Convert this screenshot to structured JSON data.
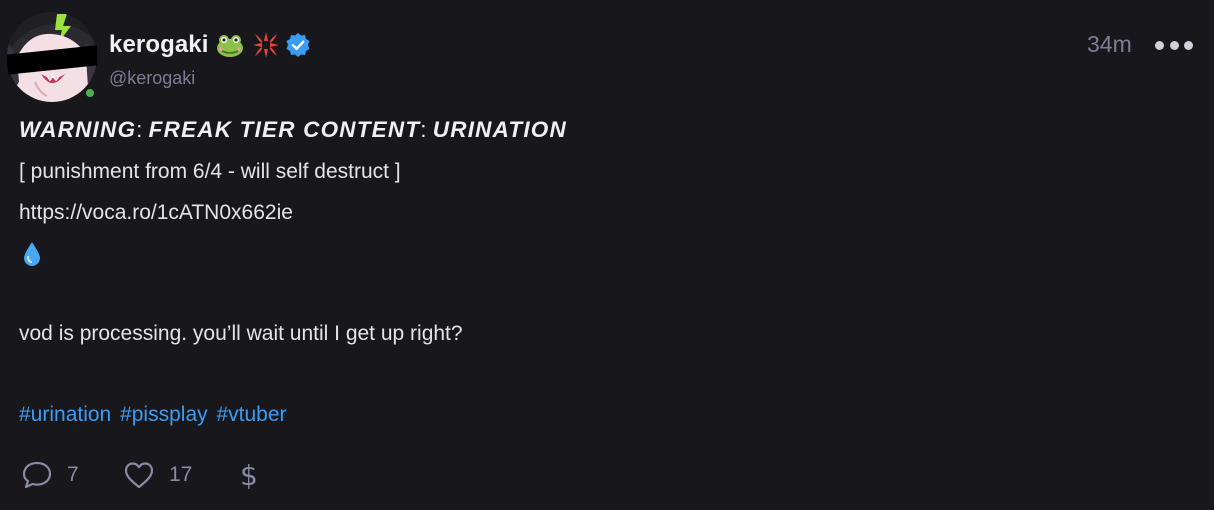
{
  "post": {
    "author": {
      "display_name": "kerogaki",
      "handle": "@kerogaki",
      "badges": [
        "frog-emoji",
        "anger-emoji",
        "verified-badge"
      ],
      "status_color": "#4cb050"
    },
    "timestamp": "34m",
    "content": {
      "warning": {
        "part1": "WARNING",
        "sep1": ": ",
        "part2": "FREAK TIER CONTENT",
        "sep2": ": ",
        "part3": "URINATION"
      },
      "punishment": "[ punishment from 6/4 - will self destruct ]",
      "link": "https://voca.ro/1cATN0x662ie",
      "drop_icon": "droplet-emoji",
      "vod_note": "vod is processing. you’ll wait until I get up right?",
      "hashtags": [
        "#urination",
        "#pissplay",
        "#vtuber"
      ]
    },
    "actions": {
      "reply_count": "7",
      "like_count": "17",
      "zap_symbol": "$"
    }
  },
  "colors": {
    "background": "#17171c",
    "accent_link": "#3a9df5",
    "muted": "#7d7e96",
    "verified": "#3a9df5"
  }
}
